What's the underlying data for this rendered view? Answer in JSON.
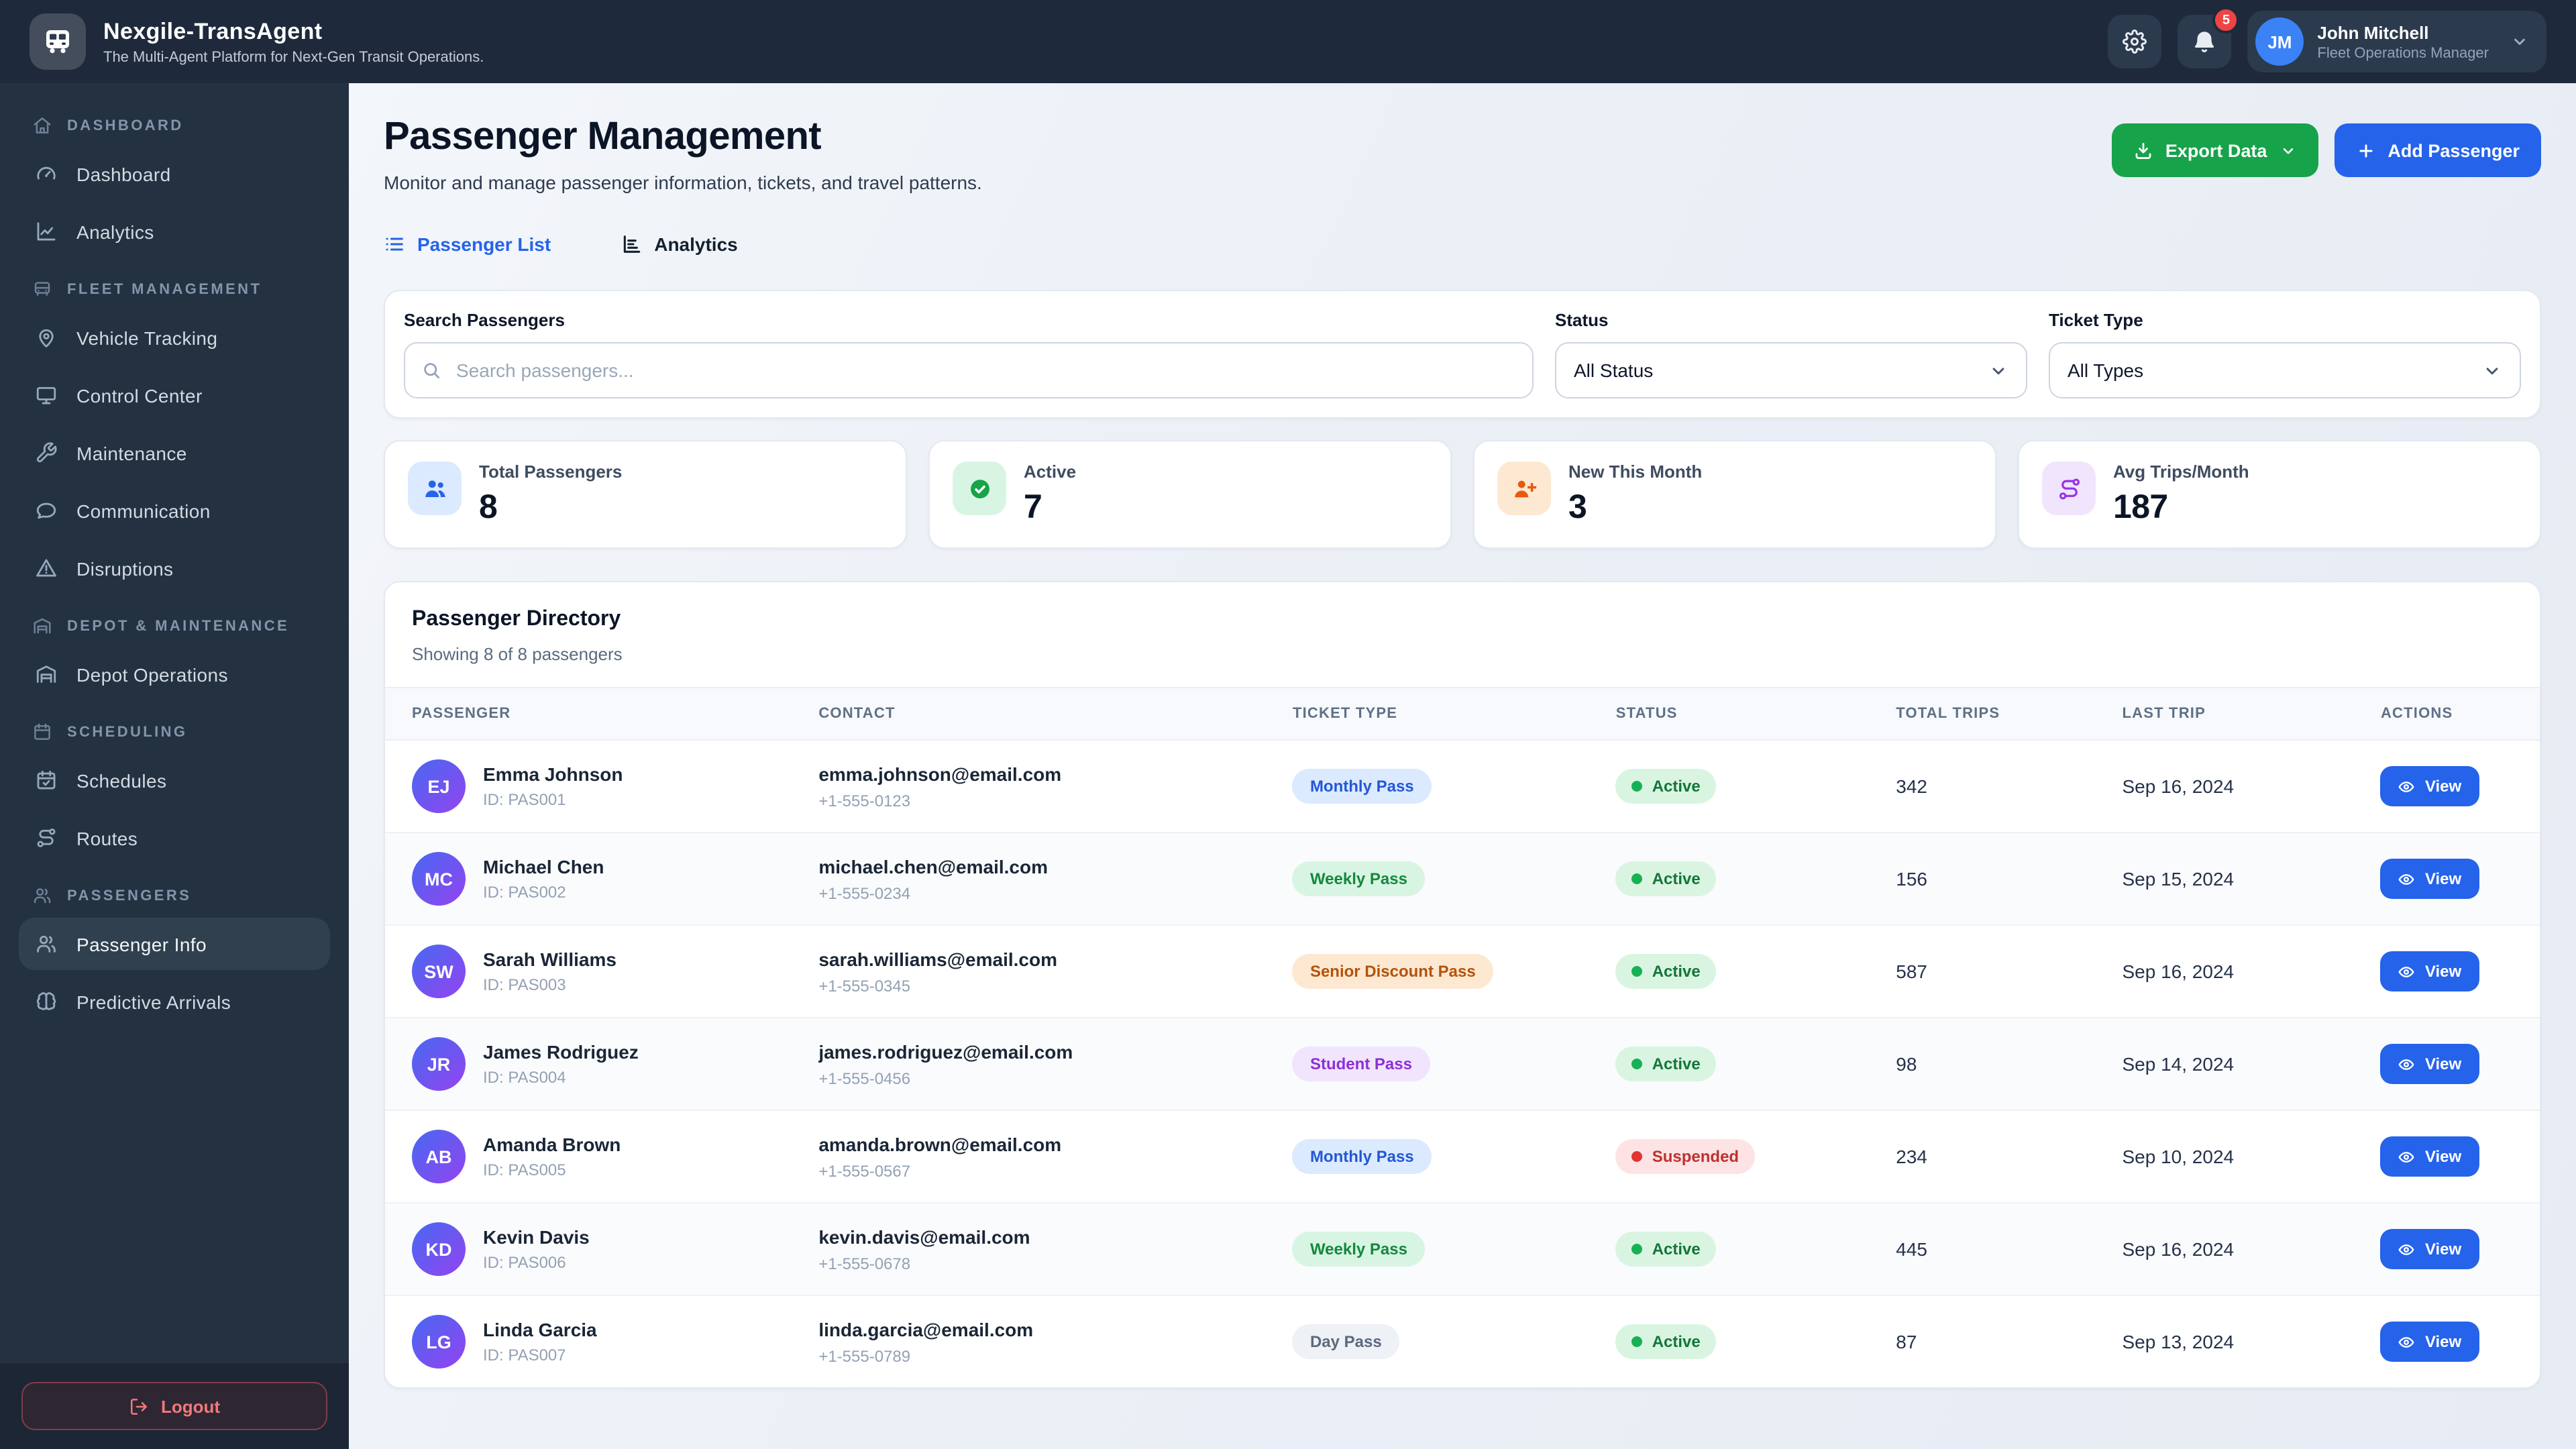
{
  "header": {
    "app_title": "Nexgile-TransAgent",
    "app_subtitle": "The Multi-Agent Platform for Next-Gen Transit Operations.",
    "notification_count": "5",
    "user": {
      "initials": "JM",
      "name": "John Mitchell",
      "role": "Fleet Operations Manager"
    }
  },
  "sidebar": {
    "sections": [
      {
        "label": "Dashboard",
        "icon": "home",
        "items": [
          {
            "label": "Dashboard",
            "icon": "gauge",
            "active": false
          },
          {
            "label": "Analytics",
            "icon": "chart-line",
            "active": false
          }
        ]
      },
      {
        "label": "Fleet Management",
        "icon": "bus",
        "items": [
          {
            "label": "Vehicle Tracking",
            "icon": "map-pin",
            "active": false
          },
          {
            "label": "Control Center",
            "icon": "monitor",
            "active": false
          },
          {
            "label": "Maintenance",
            "icon": "wrench",
            "active": false
          },
          {
            "label": "Communication",
            "icon": "chat",
            "active": false
          },
          {
            "label": "Disruptions",
            "icon": "alert-triangle",
            "active": false
          }
        ]
      },
      {
        "label": "Depot & Maintenance",
        "icon": "warehouse",
        "items": [
          {
            "label": "Depot Operations",
            "icon": "warehouse",
            "active": false
          }
        ]
      },
      {
        "label": "Scheduling",
        "icon": "calendar",
        "items": [
          {
            "label": "Schedules",
            "icon": "calendar-check",
            "active": false
          },
          {
            "label": "Routes",
            "icon": "route",
            "active": false
          }
        ]
      },
      {
        "label": "Passengers",
        "icon": "users",
        "items": [
          {
            "label": "Passenger Info",
            "icon": "users",
            "active": true
          },
          {
            "label": "Predictive Arrivals",
            "icon": "brain",
            "active": false
          }
        ]
      }
    ],
    "logout_label": "Logout"
  },
  "page": {
    "title": "Passenger Management",
    "subtitle": "Monitor and manage passenger information, tickets, and travel patterns.",
    "export_button": "Export Data",
    "add_button": "Add Passenger",
    "tabs": [
      {
        "label": "Passenger List",
        "icon": "list",
        "active": true
      },
      {
        "label": "Analytics",
        "icon": "bar-chart",
        "active": false
      }
    ]
  },
  "filters": {
    "search_label": "Search Passengers",
    "search_placeholder": "Search passengers...",
    "status_label": "Status",
    "status_value": "All Status",
    "ticket_label": "Ticket Type",
    "ticket_value": "All Types"
  },
  "stats": [
    {
      "label": "Total Passengers",
      "value": "8",
      "icon": "users-solid",
      "color": "#2563eb",
      "bg": "#dbeafe"
    },
    {
      "label": "Active",
      "value": "7",
      "icon": "check-circle",
      "color": "#16a34a",
      "bg": "#d8f5e3"
    },
    {
      "label": "New This Month",
      "value": "3",
      "icon": "user-plus",
      "color": "#ea580c",
      "bg": "#fde8d2"
    },
    {
      "label": "Avg Trips/Month",
      "value": "187",
      "icon": "route",
      "color": "#9333ea",
      "bg": "#f1e5fd"
    }
  ],
  "directory": {
    "title": "Passenger Directory",
    "subtitle": "Showing 8 of 8 passengers",
    "columns": [
      "Passenger",
      "Contact",
      "Ticket Type",
      "Status",
      "Total Trips",
      "Last Trip",
      "Actions"
    ],
    "view_label": "View",
    "rows": [
      {
        "initials": "EJ",
        "name": "Emma Johnson",
        "id": "ID: PAS001",
        "email": "emma.johnson@email.com",
        "phone": "+1-555-0123",
        "ticket": "Monthly Pass",
        "ticket_style": "blue",
        "status": "Active",
        "status_style": "active",
        "trips": "342",
        "last_trip": "Sep 16, 2024"
      },
      {
        "initials": "MC",
        "name": "Michael Chen",
        "id": "ID: PAS002",
        "email": "michael.chen@email.com",
        "phone": "+1-555-0234",
        "ticket": "Weekly Pass",
        "ticket_style": "green",
        "status": "Active",
        "status_style": "active",
        "trips": "156",
        "last_trip": "Sep 15, 2024"
      },
      {
        "initials": "SW",
        "name": "Sarah Williams",
        "id": "ID: PAS003",
        "email": "sarah.williams@email.com",
        "phone": "+1-555-0345",
        "ticket": "Senior Discount Pass",
        "ticket_style": "orange",
        "status": "Active",
        "status_style": "active",
        "trips": "587",
        "last_trip": "Sep 16, 2024"
      },
      {
        "initials": "JR",
        "name": "James Rodriguez",
        "id": "ID: PAS004",
        "email": "james.rodriguez@email.com",
        "phone": "+1-555-0456",
        "ticket": "Student Pass",
        "ticket_style": "purple",
        "status": "Active",
        "status_style": "active",
        "trips": "98",
        "last_trip": "Sep 14, 2024"
      },
      {
        "initials": "AB",
        "name": "Amanda Brown",
        "id": "ID: PAS005",
        "email": "amanda.brown@email.com",
        "phone": "+1-555-0567",
        "ticket": "Monthly Pass",
        "ticket_style": "blue",
        "status": "Suspended",
        "status_style": "suspended",
        "trips": "234",
        "last_trip": "Sep 10, 2024"
      },
      {
        "initials": "KD",
        "name": "Kevin Davis",
        "id": "ID: PAS006",
        "email": "kevin.davis@email.com",
        "phone": "+1-555-0678",
        "ticket": "Weekly Pass",
        "ticket_style": "green",
        "status": "Active",
        "status_style": "active",
        "trips": "445",
        "last_trip": "Sep 16, 2024"
      },
      {
        "initials": "LG",
        "name": "Linda Garcia",
        "id": "ID: PAS007",
        "email": "linda.garcia@email.com",
        "phone": "+1-555-0789",
        "ticket": "Day Pass",
        "ticket_style": "gray",
        "status": "Active",
        "status_style": "active",
        "trips": "87",
        "last_trip": "Sep 13, 2024"
      }
    ]
  },
  "colors": {
    "header_bg": "#1e2a3b",
    "sidebar_bg": "#243140",
    "accent_blue": "#2563eb",
    "accent_green": "#16a34a",
    "badge_red": "#ef4444",
    "status_active_dot": "#17b155",
    "avatar_gradient_start": "#4d66f1",
    "avatar_gradient_end": "#8e46f0"
  },
  "icons": {
    "bus": "bus glyph",
    "home": "house",
    "gauge": "speedometer",
    "chart-line": "line chart",
    "map-pin": "location pin",
    "monitor": "desktop screen",
    "wrench": "wrench",
    "chat": "speech bubble",
    "alert-triangle": "warning triangle",
    "warehouse": "depot garage",
    "calendar": "calendar",
    "calendar-check": "calendar with check",
    "route": "route waypoints",
    "users": "people group",
    "brain": "brain",
    "logout": "logout arrow",
    "gear": "settings gear",
    "bell": "notification bell",
    "chevron-down": "down chevron",
    "search": "magnifier",
    "download": "download tray",
    "plus": "plus",
    "eye": "eye",
    "list": "bulleted list",
    "bar-chart": "bar chart",
    "user-plus": "person with plus",
    "check-circle": "check in circle",
    "users-solid": "people group"
  }
}
